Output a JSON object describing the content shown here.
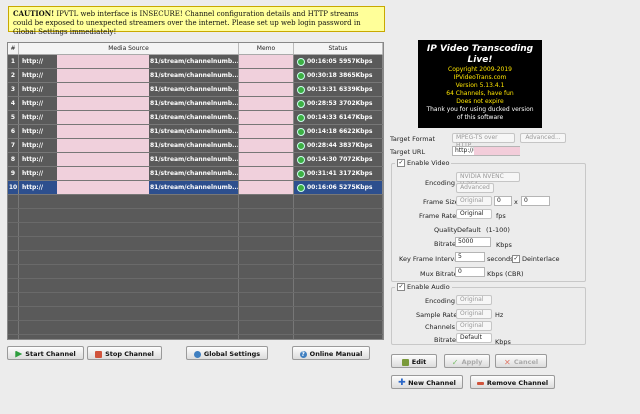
{
  "warning": {
    "bold": "CAUTION!",
    "text": "IPVTL web interface is INSECURE! Channel configuration details and HTTP streams could be exposed to unexpected streamers over the internet. Please set up web login password in Global Settings immediately!"
  },
  "table": {
    "headers": [
      "#",
      "Media Source",
      "Memo",
      "Status"
    ],
    "rows": [
      {
        "num": "1",
        "src_prefix": "http://",
        "src_tail": "81/stream/channelnumb...",
        "time": "00:16:05",
        "rate": "5957Kbps"
      },
      {
        "num": "2",
        "src_prefix": "http://",
        "src_tail": "81/stream/channelnumb...",
        "time": "00:30:18",
        "rate": "3865Kbps"
      },
      {
        "num": "3",
        "src_prefix": "http://",
        "src_tail": "81/stream/channelnumb...",
        "time": "00:13:31",
        "rate": "6339Kbps"
      },
      {
        "num": "4",
        "src_prefix": "http://",
        "src_tail": "81/stream/channelnumb...",
        "time": "00:28:53",
        "rate": "3702Kbps"
      },
      {
        "num": "5",
        "src_prefix": "http://",
        "src_tail": "81/stream/channelnumb...",
        "time": "00:14:33",
        "rate": "6147Kbps"
      },
      {
        "num": "6",
        "src_prefix": "http://",
        "src_tail": "81/stream/channelnumb...",
        "time": "00:14:18",
        "rate": "6622Kbps"
      },
      {
        "num": "7",
        "src_prefix": "http://",
        "src_tail": "81/stream/channelnumb...",
        "time": "00:28:44",
        "rate": "3837Kbps"
      },
      {
        "num": "8",
        "src_prefix": "http://",
        "src_tail": "81/stream/channelnumb...",
        "time": "00:14:30",
        "rate": "7072Kbps"
      },
      {
        "num": "9",
        "src_prefix": "http://",
        "src_tail": "81/stream/channelnumb...",
        "time": "00:31:41",
        "rate": "3172Kbps"
      },
      {
        "num": "10",
        "src_prefix": "http://",
        "src_tail": "81/stream/channelnumb...",
        "time": "00:16:06",
        "rate": "5275Kbps"
      }
    ]
  },
  "buttons": {
    "start": "Start Channel",
    "stop": "Stop Channel",
    "global": "Global Settings",
    "manual": "Online Manual",
    "edit": "Edit",
    "apply": "Apply",
    "cancel": "Cancel",
    "new": "New Channel",
    "remove": "Remove Channel"
  },
  "logo": {
    "title": "IP Video Transcoding Live!",
    "copyright": "Copyright 2009-2019",
    "site": "IPVideoTrans.com",
    "version": "Version 5.13.4.1",
    "channels": "64 Channels, have fun",
    "expire": "Does not expire",
    "thanks": "Thank you for using ducked version of this software"
  },
  "form": {
    "target_format_label": "Target Format",
    "target_format": "MPEG-TS over HTTP",
    "advanced": "Advanced...",
    "target_url_label": "Target URL",
    "target_url": "http://0.0.0.0:",
    "enable_video": "Enable Video",
    "encoding_label": "Encoding",
    "encoding": "NVIDIA NVENC H.264",
    "encoding_adv": "Advanced",
    "frame_size_label": "Frame Size",
    "frame_size": "Original",
    "width": "0",
    "x": "x",
    "height": "0",
    "frame_rate_label": "Frame Rate",
    "frame_rate": "Original",
    "fps": "fps",
    "quality_label": "Quality",
    "quality": "Default",
    "quality_range": "(1-100)",
    "bitrate_label": "Bitrate",
    "bitrate": "5000",
    "kbps": "Kbps",
    "kfi_label": "Key Frame Interval",
    "kfi": "5",
    "seconds": "seconds",
    "deinterlace": "Deinterlace",
    "mux_label": "Mux Bitrate",
    "mux": "0",
    "kbps_cbr": "Kbps (CBR)",
    "enable_audio": "Enable Audio",
    "a_encoding_label": "Encoding",
    "a_encoding": "Original",
    "sample_rate_label": "Sample Rate",
    "sample_rate": "Original",
    "hz": "Hz",
    "channels_label": "Channels",
    "channels": "Original",
    "a_bitrate_label": "Bitrate",
    "a_bitrate": "Default",
    "a_kbps": "Kbps"
  },
  "colors": {
    "warning_bg": "#ffff99",
    "selected_row": "#2d4f8e",
    "status_ok": "#3cb043"
  }
}
